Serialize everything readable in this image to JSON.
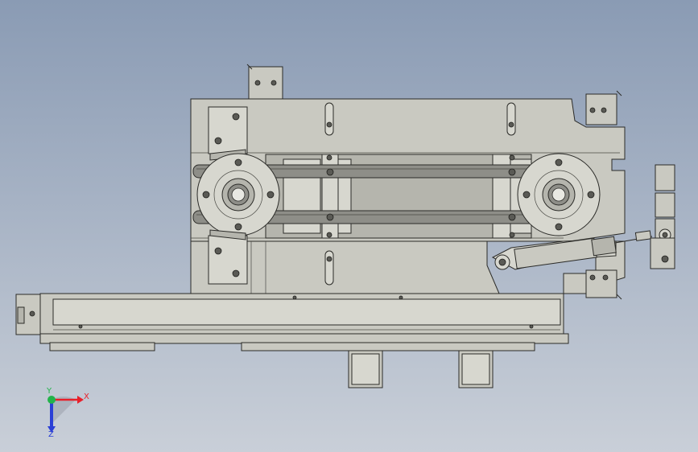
{
  "viewport": {
    "background_top": "#8a9bb4",
    "background_bottom": "#c9cfd8"
  },
  "triad": {
    "x_label": "X",
    "y_label": "Y",
    "z_label": "Z",
    "x_color": "#e8202a",
    "y_color": "#23b34a",
    "z_color": "#2a3fd6"
  }
}
